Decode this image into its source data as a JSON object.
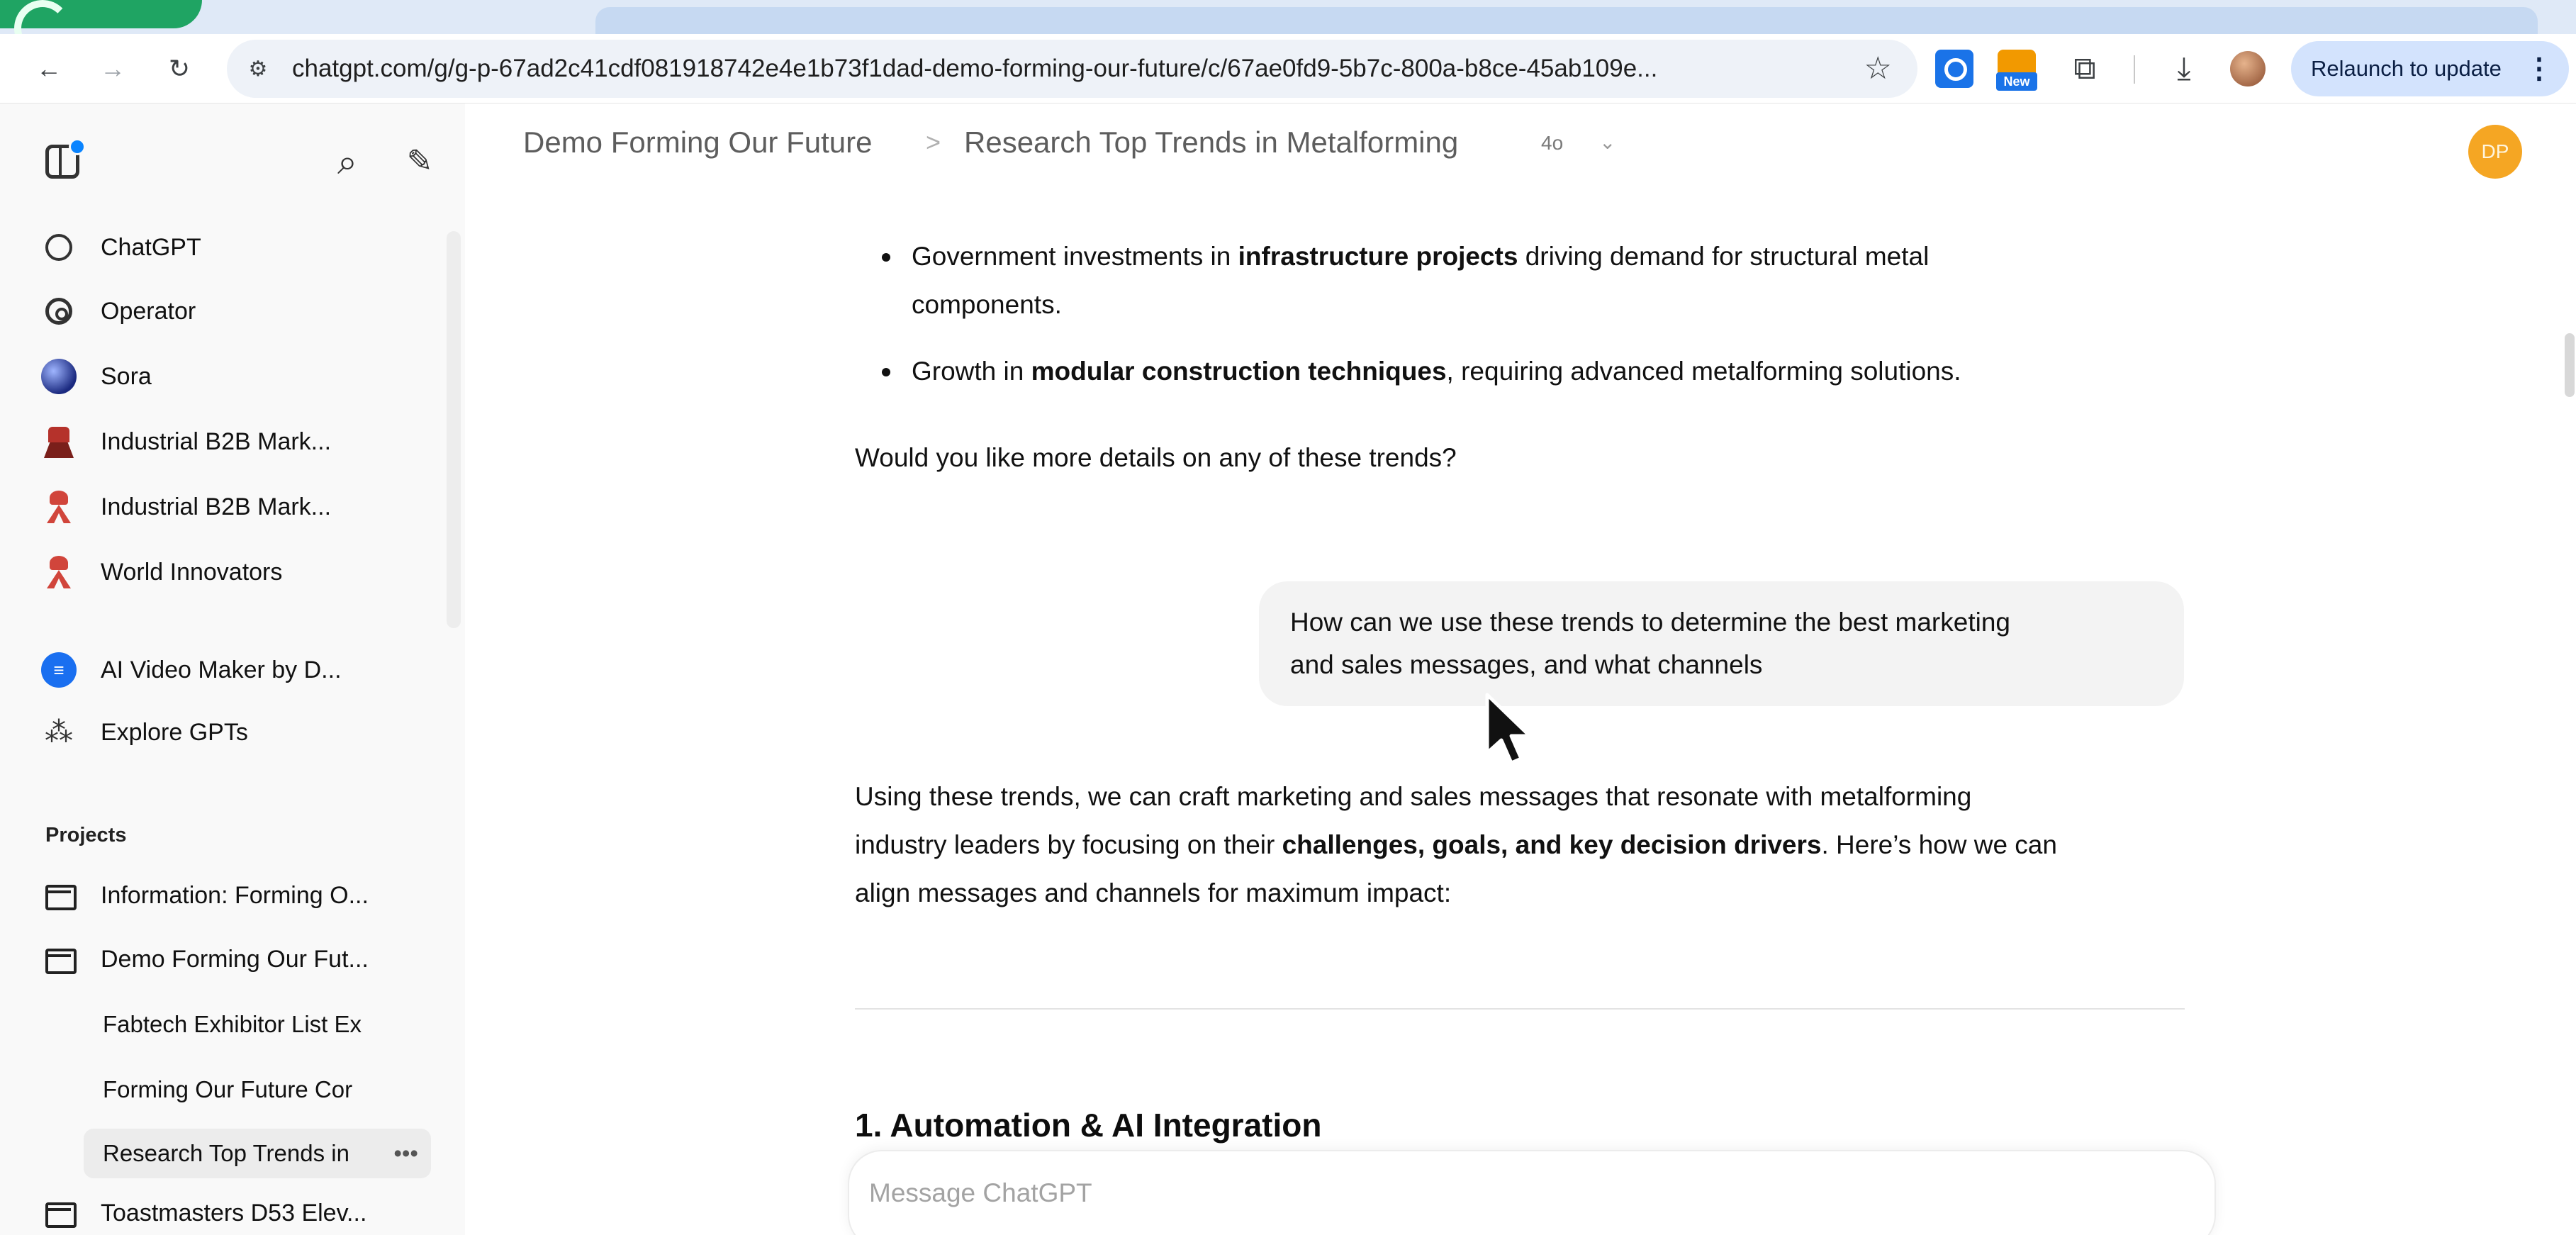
{
  "browser": {
    "url": "chatgpt.com/g/g-p-67ad2c41cdf081918742e4e1b73f1dad-demo-forming-our-future/c/67ae0fd9-5b7c-800a-b8ce-45ab109e...",
    "relaunch_label": "Relaunch to update",
    "extension_badge": "New",
    "icons": [
      "back-arrow-icon",
      "forward-arrow-icon",
      "reload-icon",
      "site-settings-icon",
      "bookmark-star-icon",
      "extensions-puzzle-icon",
      "download-icon",
      "more-vert-icon"
    ]
  },
  "sidebar": {
    "top_items": [
      {
        "label": "ChatGPT",
        "icon": "openai-logo-icon"
      },
      {
        "label": "Operator",
        "icon": "operator-icon"
      },
      {
        "label": "Sora",
        "icon": "sora-icon"
      },
      {
        "label": "Industrial B2B Mark...",
        "icon": "gpt-robot-icon"
      },
      {
        "label": "Industrial B2B Mark...",
        "icon": "gpt-figure-icon"
      },
      {
        "label": "World Innovators",
        "icon": "gpt-figure-icon"
      },
      {
        "label": "AI Video Maker by D...",
        "icon": "video-maker-icon"
      },
      {
        "label": "Explore GPTs",
        "icon": "grid-icon"
      }
    ],
    "projects_heading": "Projects",
    "projects": [
      {
        "label": "Information: Forming O..."
      },
      {
        "label": "Demo Forming Our Fut..."
      }
    ],
    "project_chats": [
      {
        "label": "Fabtech Exhibitor List Ex"
      },
      {
        "label": "Forming Our Future Cor"
      },
      {
        "label": "Research Top Trends in",
        "more": "•••"
      }
    ],
    "more_projects": [
      {
        "label": "Toastmasters D53 Elev..."
      }
    ]
  },
  "header": {
    "project": "Demo Forming Our Future",
    "separator": ">",
    "chat_title": "Research Top Trends in Metalforming",
    "model": "4o",
    "avatar_initials": "DP"
  },
  "conversation": {
    "bullet_1": {
      "pre": "Government investments in ",
      "bold": "infrastructure projects",
      "post_line1": " driving demand for structural metal",
      "line2": "components."
    },
    "bullet_2": {
      "pre": "Growth in ",
      "bold": "modular construction techniques",
      "post": ", requiring advanced metalforming solutions."
    },
    "followup_question": "Would you like more details on any of these trends?",
    "user_message_line1": "How can we use these trends to determine the best marketing",
    "user_message_line2": "and sales messages, and what channels",
    "answer": {
      "line1": "Using these trends, we can craft marketing and sales messages that resonate with metalforming",
      "line2_pre": "industry leaders by focusing on their ",
      "line2_bold": "challenges, goals, and key decision drivers",
      "line2_post": ". Here’s how we can",
      "line3": "align messages and channels for maximum impact:"
    },
    "section_heading": "1. Automation & AI Integration"
  },
  "composer": {
    "placeholder": "Message ChatGPT"
  }
}
